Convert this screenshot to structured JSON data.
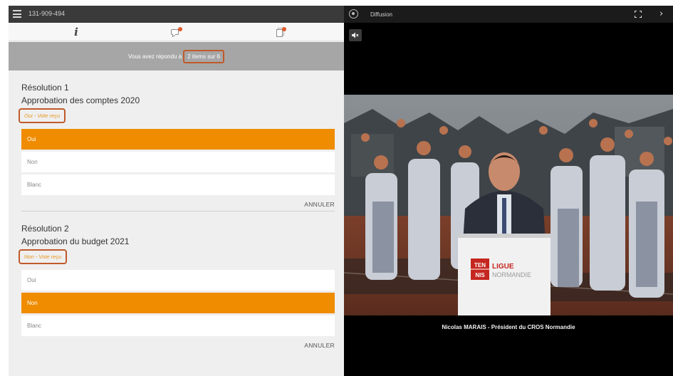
{
  "session": {
    "id": "131-909-494"
  },
  "tabs": [
    {
      "name": "info",
      "icon": "info-icon"
    },
    {
      "name": "chat",
      "icon": "chat-icon",
      "has_notification": true
    },
    {
      "name": "documents",
      "icon": "documents-icon",
      "has_notification": true
    }
  ],
  "banner": {
    "prefix": "Vous avez répondu à",
    "count_text": "2 items sur 6"
  },
  "resolutions": [
    {
      "number": "Résolution 1",
      "title": "Approbation des comptes 2020",
      "status": "Oui - Vote reçu",
      "options": [
        "Oui",
        "Non",
        "Blanc"
      ],
      "selected": "Oui",
      "cancel_label": "ANNULER"
    },
    {
      "number": "Résolution 2",
      "title": "Approbation du budget 2021",
      "status": "Non - Vote reçu",
      "options": [
        "Oui",
        "Non",
        "Blanc"
      ],
      "selected": "Non",
      "cancel_label": "ANNULER"
    }
  ],
  "broadcast": {
    "title": "Diffusion",
    "caption": "Nicolas MARAIS - Président du CROS Normandie",
    "podium_brand_top": "TEN",
    "podium_brand_bottom": "NIS",
    "podium_text_1": "LIGUE",
    "podium_text_2": "NORMANDIE"
  },
  "colors": {
    "accent": "#ef8c00",
    "highlight_border": "#c05a2a",
    "status_text": "#e8961b",
    "banner_bg": "#a6a6a6"
  }
}
